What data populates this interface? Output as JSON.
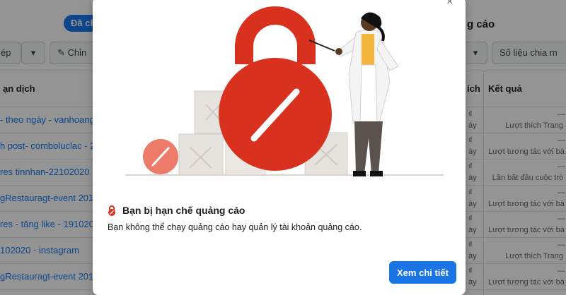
{
  "background": {
    "chip_label": "Đã ch",
    "right_title": "g cáo",
    "close_glyph": "×",
    "toolbar": {
      "left_btn": "ép",
      "dropdown_glyph": "▾",
      "edit_label": "✎ Chỉn",
      "metrics_label": "Số liệu chia m"
    },
    "table": {
      "col_name": "ạn dịch",
      "col_extra": "ích",
      "col_result": "Kết quả",
      "rows": [
        {
          "name": "- theo ngày - vanhoangre",
          "a": "₫",
          "b": "ày",
          "dash": "—",
          "result": "Lượt thích Trang"
        },
        {
          "name": "h post- comboluclac - 24",
          "a": "₫",
          "b": "ày",
          "dash": "—",
          "result": "Lượt tương tác với bà"
        },
        {
          "name": "res tinnhan-22102020",
          "a": "₫",
          "b": "ày",
          "dash": "—",
          "result": "Lần bắt đầu cuộc trò"
        },
        {
          "name": "gRestauragt-event 2010",
          "a": "₫",
          "b": "ày",
          "dash": "—",
          "result": "Lượt tương tác với bà"
        },
        {
          "name": "res - tăng like - 191020",
          "a": "₫",
          "b": "ày",
          "dash": "—",
          "result": "Lượt tương tác với bà"
        },
        {
          "name": "102020 - instagram",
          "a": "₫",
          "b": "ày",
          "dash": "—",
          "result": "Lượt thích Trang"
        },
        {
          "name": "gRestauragt-event 2010",
          "a": "₫",
          "b": "ày",
          "dash": "—",
          "result": "Lượt tương tác với bà"
        }
      ]
    }
  },
  "modal": {
    "heading": "Bạn bị hạn chế quảng cáo",
    "body": "Bạn không thể chạy quảng cáo hay quản lý tài khoản quảng cáo.",
    "primary_button": "Xem chi tiết",
    "colors": {
      "accent": "#1b74e4",
      "lock_red": "#d8321f",
      "coin_salmon": "#ed7b6a",
      "box_light": "#e8e4e0"
    }
  }
}
